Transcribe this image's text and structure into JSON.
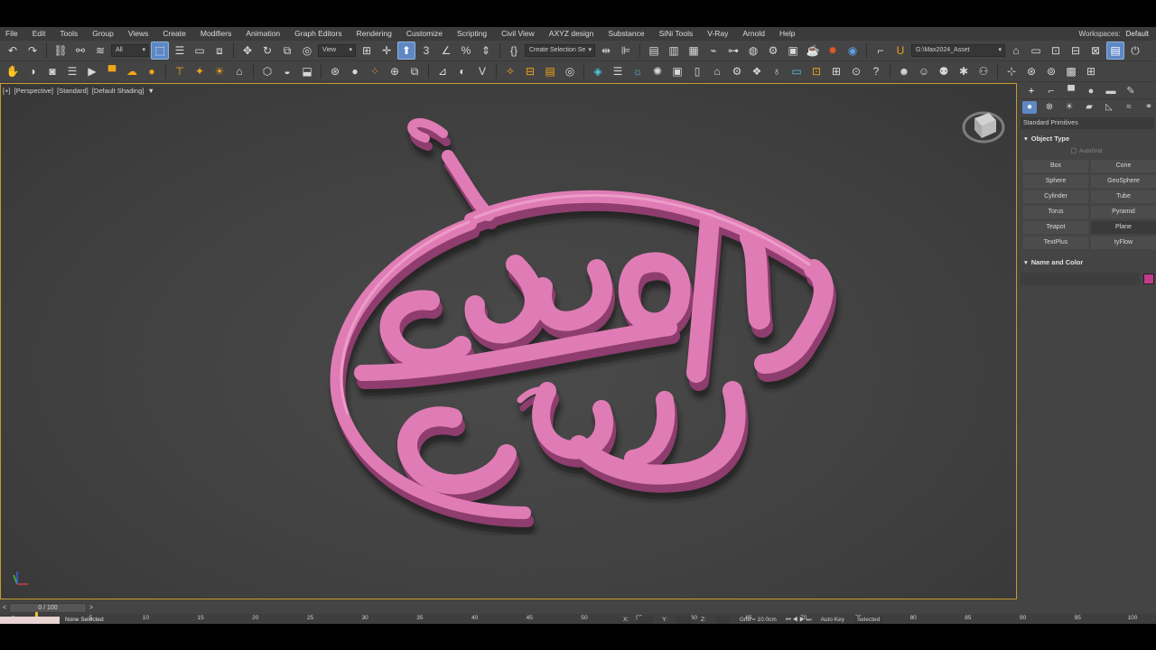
{
  "menus": [
    "File",
    "Edit",
    "Tools",
    "Group",
    "Views",
    "Create",
    "Modifiers",
    "Animation",
    "Graph Editors",
    "Rendering",
    "Customize",
    "Scripting",
    "Civil View",
    "AXYZ design",
    "Substance",
    "SiNi Tools",
    "V-Ray",
    "Arnold",
    "Help"
  ],
  "workspaces": {
    "label": "Workspaces:",
    "value": "Default"
  },
  "toolbar": {
    "filter_value": "All",
    "refcoord_value": "View",
    "selection_set_placeholder": "Create Selection Se",
    "project_path": "G:\\Max2024_Asset"
  },
  "viewport": {
    "label_plus": "[+]",
    "label_view": "[Perspective]",
    "label_mode": "[Standard]",
    "label_shading": "[Default Shading]",
    "logo_color": "#e07bb5"
  },
  "command_panel": {
    "category": "Standard Primitives",
    "object_type_title": "Object Type",
    "autogrid_label": "AutoGrid",
    "primitives": [
      "Box",
      "Cone",
      "Sphere",
      "GeoSphere",
      "Cylinder",
      "Tube",
      "Torus",
      "Pyramid",
      "Teapot",
      "Plane",
      "TextPlus",
      "tyFlow"
    ],
    "name_color_title": "Name and Color",
    "object_color": "#c23a8a"
  },
  "time_slider": {
    "value": "0 / 100",
    "prev": "<",
    "next": ">"
  },
  "trackbar": {
    "ticks": [
      "0",
      "5",
      "10",
      "15",
      "20",
      "25",
      "30",
      "35",
      "40",
      "45",
      "50",
      "55",
      "60",
      "65",
      "70",
      "75",
      "80",
      "85",
      "90",
      "95",
      "100"
    ]
  },
  "status": {
    "selection": "None Selected",
    "x_label": "X:",
    "y_label": "Y:",
    "z_label": "Z:",
    "grid": "Grid = 10.0cm",
    "auto_key": "Auto Key",
    "selected": "Selected"
  }
}
